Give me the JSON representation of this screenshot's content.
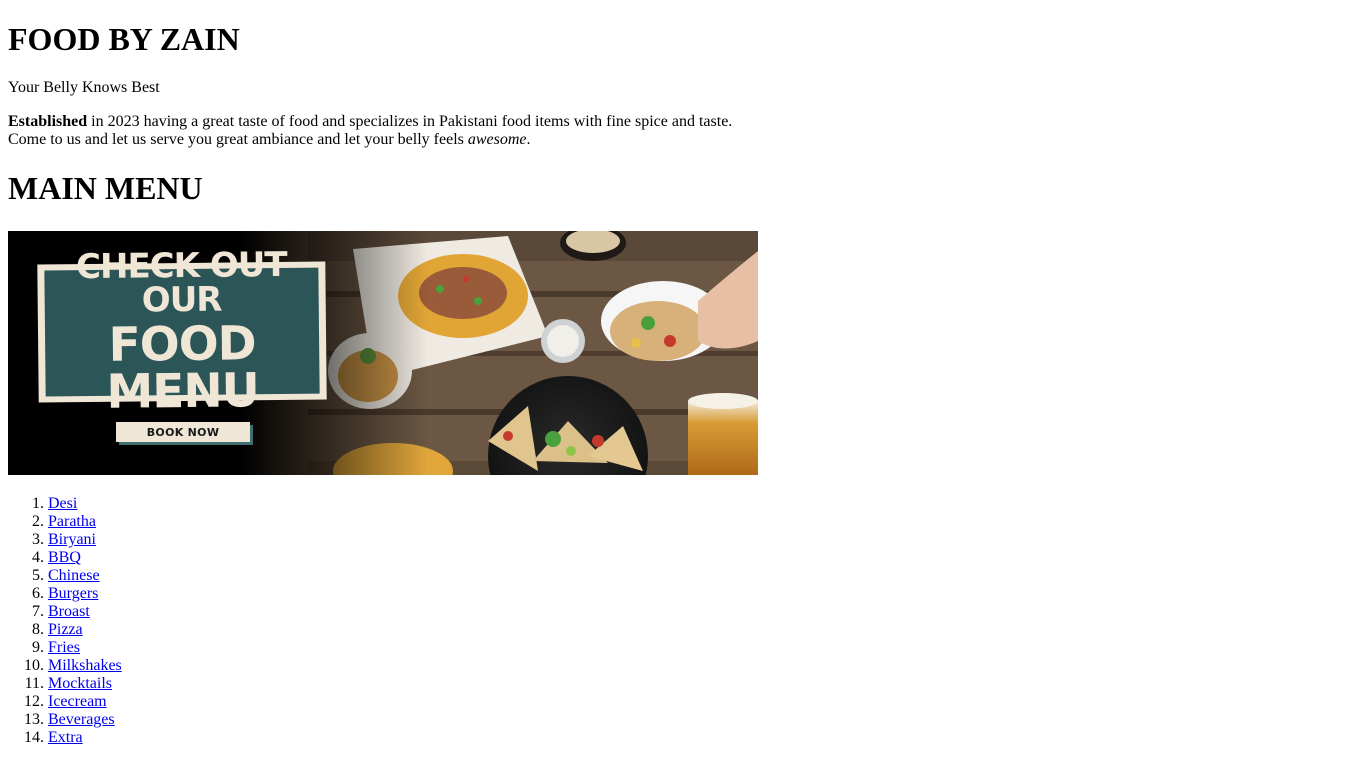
{
  "header": {
    "title": "FOOD BY ZAIN",
    "tagline": "Your Belly Knows Best"
  },
  "intro": {
    "bold": "Established",
    "part1": " in 2023 having a great taste of food and specializes in Pakistani food items with fine spice and taste.",
    "part2": "Come to us and let us serve you great ambiance and let your belly feels ",
    "italic": "awesome",
    "end": "."
  },
  "menu": {
    "heading": "MAIN MENU",
    "banner": {
      "line1": "CHECK OUT OUR",
      "line2": "FOOD MENU",
      "button": "BOOK NOW"
    },
    "items": [
      "Desi",
      "Paratha",
      "Biryani",
      "BBQ",
      "Chinese",
      "Burgers",
      "Broast",
      "Pizza",
      "Fries",
      "Milkshakes",
      "Mocktails",
      "Icecream",
      "Beverages",
      "Extra"
    ]
  },
  "colors": {
    "link": "#0000ee",
    "banner_panel": "#2c5558",
    "banner_cream": "#efe6d6",
    "table_wood": "#6b5743"
  }
}
